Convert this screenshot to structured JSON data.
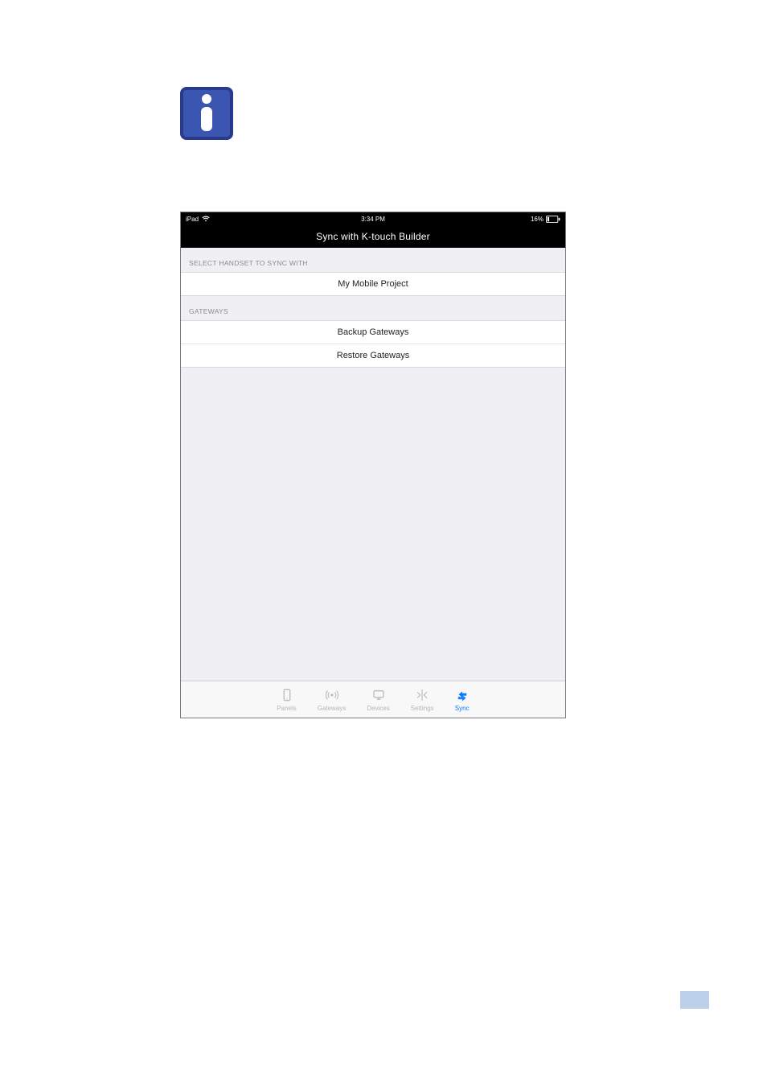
{
  "statusbar": {
    "device": "iPad",
    "time": "3:34 PM",
    "battery_pct": "16%"
  },
  "navbar": {
    "title": "Sync with K-touch Builder"
  },
  "sections": {
    "handset_header": "SELECT HANDSET TO SYNC WITH",
    "handset_item": "My Mobile Project",
    "gateways_header": "GATEWAYS",
    "backup_label": "Backup Gateways",
    "restore_label": "Restore Gateways"
  },
  "tabs": {
    "panels": "Panels",
    "gateways": "Gateways",
    "devices": "Devices",
    "settings": "Settings",
    "sync": "Sync"
  },
  "page_number": ""
}
